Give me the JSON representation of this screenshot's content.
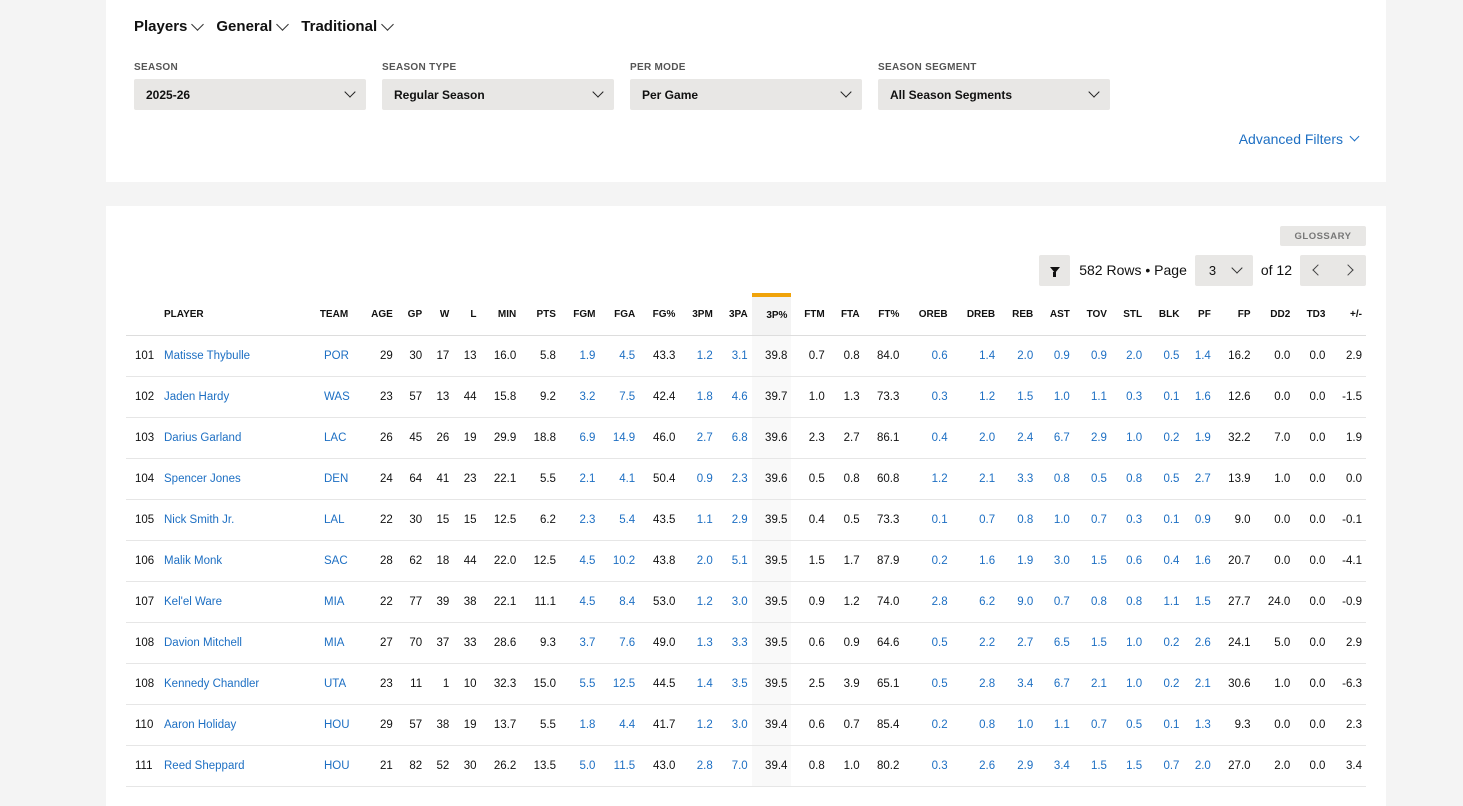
{
  "nav": {
    "items": [
      {
        "label": "Players"
      },
      {
        "label": "General"
      },
      {
        "label": "Traditional"
      }
    ]
  },
  "filters": [
    {
      "label": "SEASON",
      "value": "2025-26"
    },
    {
      "label": "SEASON TYPE",
      "value": "Regular Season"
    },
    {
      "label": "PER MODE",
      "value": "Per Game"
    },
    {
      "label": "SEASON SEGMENT",
      "value": "All Season Segments"
    }
  ],
  "advanced_filters_label": "Advanced Filters",
  "glossary_label": "GLOSSARY",
  "pager": {
    "rows_text": "582 Rows • Page",
    "page": "3",
    "of_text": "of 12"
  },
  "colors": {
    "link": "#1d6fc3",
    "sort_accent": "#f0a30a"
  },
  "table": {
    "columns": [
      "PLAYER",
      "TEAM",
      "AGE",
      "GP",
      "W",
      "L",
      "MIN",
      "PTS",
      "FGM",
      "FGA",
      "FG%",
      "3PM",
      "3PA",
      "3P%",
      "FTM",
      "FTA",
      "FT%",
      "OREB",
      "DREB",
      "REB",
      "AST",
      "TOV",
      "STL",
      "BLK",
      "PF",
      "FP",
      "DD2",
      "TD3",
      "+/-"
    ],
    "sorted_column": "3P%",
    "rows": [
      {
        "rank": "101",
        "player": "Matisse Thybulle",
        "team": "POR",
        "age": "29",
        "gp": "30",
        "w": "17",
        "l": "13",
        "min": "16.0",
        "pts": "5.8",
        "fgm": "1.9",
        "fga": "4.5",
        "fgp": "43.3",
        "tpm": "1.2",
        "tpa": "3.1",
        "tpp": "39.8",
        "ftm": "0.7",
        "fta": "0.8",
        "ftp": "84.0",
        "oreb": "0.6",
        "dreb": "1.4",
        "reb": "2.0",
        "ast": "0.9",
        "tov": "0.9",
        "stl": "2.0",
        "blk": "0.5",
        "pf": "1.4",
        "fp": "16.2",
        "dd2": "0.0",
        "td3": "0.0",
        "pm": "2.9"
      },
      {
        "rank": "102",
        "player": "Jaden Hardy",
        "team": "WAS",
        "age": "23",
        "gp": "57",
        "w": "13",
        "l": "44",
        "min": "15.8",
        "pts": "9.2",
        "fgm": "3.2",
        "fga": "7.5",
        "fgp": "42.4",
        "tpm": "1.8",
        "tpa": "4.6",
        "tpp": "39.7",
        "ftm": "1.0",
        "fta": "1.3",
        "ftp": "73.3",
        "oreb": "0.3",
        "dreb": "1.2",
        "reb": "1.5",
        "ast": "1.0",
        "tov": "1.1",
        "stl": "0.3",
        "blk": "0.1",
        "pf": "1.6",
        "fp": "12.6",
        "dd2": "0.0",
        "td3": "0.0",
        "pm": "-1.5"
      },
      {
        "rank": "103",
        "player": "Darius Garland",
        "team": "LAC",
        "age": "26",
        "gp": "45",
        "w": "26",
        "l": "19",
        "min": "29.9",
        "pts": "18.8",
        "fgm": "6.9",
        "fga": "14.9",
        "fgp": "46.0",
        "tpm": "2.7",
        "tpa": "6.8",
        "tpp": "39.6",
        "ftm": "2.3",
        "fta": "2.7",
        "ftp": "86.1",
        "oreb": "0.4",
        "dreb": "2.0",
        "reb": "2.4",
        "ast": "6.7",
        "tov": "2.9",
        "stl": "1.0",
        "blk": "0.2",
        "pf": "1.9",
        "fp": "32.2",
        "dd2": "7.0",
        "td3": "0.0",
        "pm": "1.9"
      },
      {
        "rank": "104",
        "player": "Spencer Jones",
        "team": "DEN",
        "age": "24",
        "gp": "64",
        "w": "41",
        "l": "23",
        "min": "22.1",
        "pts": "5.5",
        "fgm": "2.1",
        "fga": "4.1",
        "fgp": "50.4",
        "tpm": "0.9",
        "tpa": "2.3",
        "tpp": "39.6",
        "ftm": "0.5",
        "fta": "0.8",
        "ftp": "60.8",
        "oreb": "1.2",
        "dreb": "2.1",
        "reb": "3.3",
        "ast": "0.8",
        "tov": "0.5",
        "stl": "0.8",
        "blk": "0.5",
        "pf": "2.7",
        "fp": "13.9",
        "dd2": "1.0",
        "td3": "0.0",
        "pm": "0.0"
      },
      {
        "rank": "105",
        "player": "Nick Smith Jr.",
        "team": "LAL",
        "age": "22",
        "gp": "30",
        "w": "15",
        "l": "15",
        "min": "12.5",
        "pts": "6.2",
        "fgm": "2.3",
        "fga": "5.4",
        "fgp": "43.5",
        "tpm": "1.1",
        "tpa": "2.9",
        "tpp": "39.5",
        "ftm": "0.4",
        "fta": "0.5",
        "ftp": "73.3",
        "oreb": "0.1",
        "dreb": "0.7",
        "reb": "0.8",
        "ast": "1.0",
        "tov": "0.7",
        "stl": "0.3",
        "blk": "0.1",
        "pf": "0.9",
        "fp": "9.0",
        "dd2": "0.0",
        "td3": "0.0",
        "pm": "-0.1"
      },
      {
        "rank": "106",
        "player": "Malik Monk",
        "team": "SAC",
        "age": "28",
        "gp": "62",
        "w": "18",
        "l": "44",
        "min": "22.0",
        "pts": "12.5",
        "fgm": "4.5",
        "fga": "10.2",
        "fgp": "43.8",
        "tpm": "2.0",
        "tpa": "5.1",
        "tpp": "39.5",
        "ftm": "1.5",
        "fta": "1.7",
        "ftp": "87.9",
        "oreb": "0.2",
        "dreb": "1.6",
        "reb": "1.9",
        "ast": "3.0",
        "tov": "1.5",
        "stl": "0.6",
        "blk": "0.4",
        "pf": "1.6",
        "fp": "20.7",
        "dd2": "0.0",
        "td3": "0.0",
        "pm": "-4.1"
      },
      {
        "rank": "107",
        "player": "Kel'el Ware",
        "team": "MIA",
        "age": "22",
        "gp": "77",
        "w": "39",
        "l": "38",
        "min": "22.1",
        "pts": "11.1",
        "fgm": "4.5",
        "fga": "8.4",
        "fgp": "53.0",
        "tpm": "1.2",
        "tpa": "3.0",
        "tpp": "39.5",
        "ftm": "0.9",
        "fta": "1.2",
        "ftp": "74.0",
        "oreb": "2.8",
        "dreb": "6.2",
        "reb": "9.0",
        "ast": "0.7",
        "tov": "0.8",
        "stl": "0.8",
        "blk": "1.1",
        "pf": "1.5",
        "fp": "27.7",
        "dd2": "24.0",
        "td3": "0.0",
        "pm": "-0.9"
      },
      {
        "rank": "108",
        "player": "Davion Mitchell",
        "team": "MIA",
        "age": "27",
        "gp": "70",
        "w": "37",
        "l": "33",
        "min": "28.6",
        "pts": "9.3",
        "fgm": "3.7",
        "fga": "7.6",
        "fgp": "49.0",
        "tpm": "1.3",
        "tpa": "3.3",
        "tpp": "39.5",
        "ftm": "0.6",
        "fta": "0.9",
        "ftp": "64.6",
        "oreb": "0.5",
        "dreb": "2.2",
        "reb": "2.7",
        "ast": "6.5",
        "tov": "1.5",
        "stl": "1.0",
        "blk": "0.2",
        "pf": "2.6",
        "fp": "24.1",
        "dd2": "5.0",
        "td3": "0.0",
        "pm": "2.9"
      },
      {
        "rank": "108",
        "player": "Kennedy Chandler",
        "team": "UTA",
        "age": "23",
        "gp": "11",
        "w": "1",
        "l": "10",
        "min": "32.3",
        "pts": "15.0",
        "fgm": "5.5",
        "fga": "12.5",
        "fgp": "44.5",
        "tpm": "1.4",
        "tpa": "3.5",
        "tpp": "39.5",
        "ftm": "2.5",
        "fta": "3.9",
        "ftp": "65.1",
        "oreb": "0.5",
        "dreb": "2.8",
        "reb": "3.4",
        "ast": "6.7",
        "tov": "2.1",
        "stl": "1.0",
        "blk": "0.2",
        "pf": "2.1",
        "fp": "30.6",
        "dd2": "1.0",
        "td3": "0.0",
        "pm": "-6.3"
      },
      {
        "rank": "110",
        "player": "Aaron Holiday",
        "team": "HOU",
        "age": "29",
        "gp": "57",
        "w": "38",
        "l": "19",
        "min": "13.7",
        "pts": "5.5",
        "fgm": "1.8",
        "fga": "4.4",
        "fgp": "41.7",
        "tpm": "1.2",
        "tpa": "3.0",
        "tpp": "39.4",
        "ftm": "0.6",
        "fta": "0.7",
        "ftp": "85.4",
        "oreb": "0.2",
        "dreb": "0.8",
        "reb": "1.0",
        "ast": "1.1",
        "tov": "0.7",
        "stl": "0.5",
        "blk": "0.1",
        "pf": "1.3",
        "fp": "9.3",
        "dd2": "0.0",
        "td3": "0.0",
        "pm": "2.3"
      },
      {
        "rank": "111",
        "player": "Reed Sheppard",
        "team": "HOU",
        "age": "21",
        "gp": "82",
        "w": "52",
        "l": "30",
        "min": "26.2",
        "pts": "13.5",
        "fgm": "5.0",
        "fga": "11.5",
        "fgp": "43.0",
        "tpm": "2.8",
        "tpa": "7.0",
        "tpp": "39.4",
        "ftm": "0.8",
        "fta": "1.0",
        "ftp": "80.2",
        "oreb": "0.3",
        "dreb": "2.6",
        "reb": "2.9",
        "ast": "3.4",
        "tov": "1.5",
        "stl": "1.5",
        "blk": "0.7",
        "pf": "2.0",
        "fp": "27.0",
        "dd2": "2.0",
        "td3": "0.0",
        "pm": "3.4"
      }
    ]
  }
}
